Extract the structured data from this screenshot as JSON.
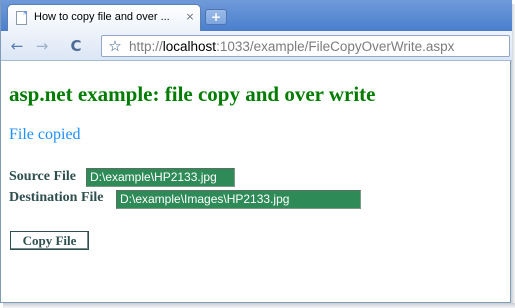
{
  "browser": {
    "tab": {
      "title": "How to copy file and over ...",
      "close_glyph": "×",
      "icon": "page-icon"
    },
    "new_tab_glyph": "+",
    "toolbar": {
      "back_glyph": "←",
      "forward_glyph": "→",
      "reload_glyph": "C",
      "star_glyph": "☆"
    },
    "address": {
      "scheme": "http://",
      "host": "localhost",
      "rest": ":1033/example/FileCopyOverWrite.aspx"
    }
  },
  "page": {
    "heading": "asp.net example: file copy and over write",
    "status": "File copied",
    "source_label": "Source File",
    "source_value": "D:\\example\\HP2133.jpg",
    "destination_label": "Destination File",
    "destination_value": "D:\\example\\Images\\HP2133.jpg",
    "copy_button": "Copy File"
  },
  "colors": {
    "heading": "#007d00",
    "status": "#1e90ff",
    "label": "#2f4f4f",
    "field_bg": "#2e8b57",
    "tabstrip": "#5b8bd4"
  }
}
